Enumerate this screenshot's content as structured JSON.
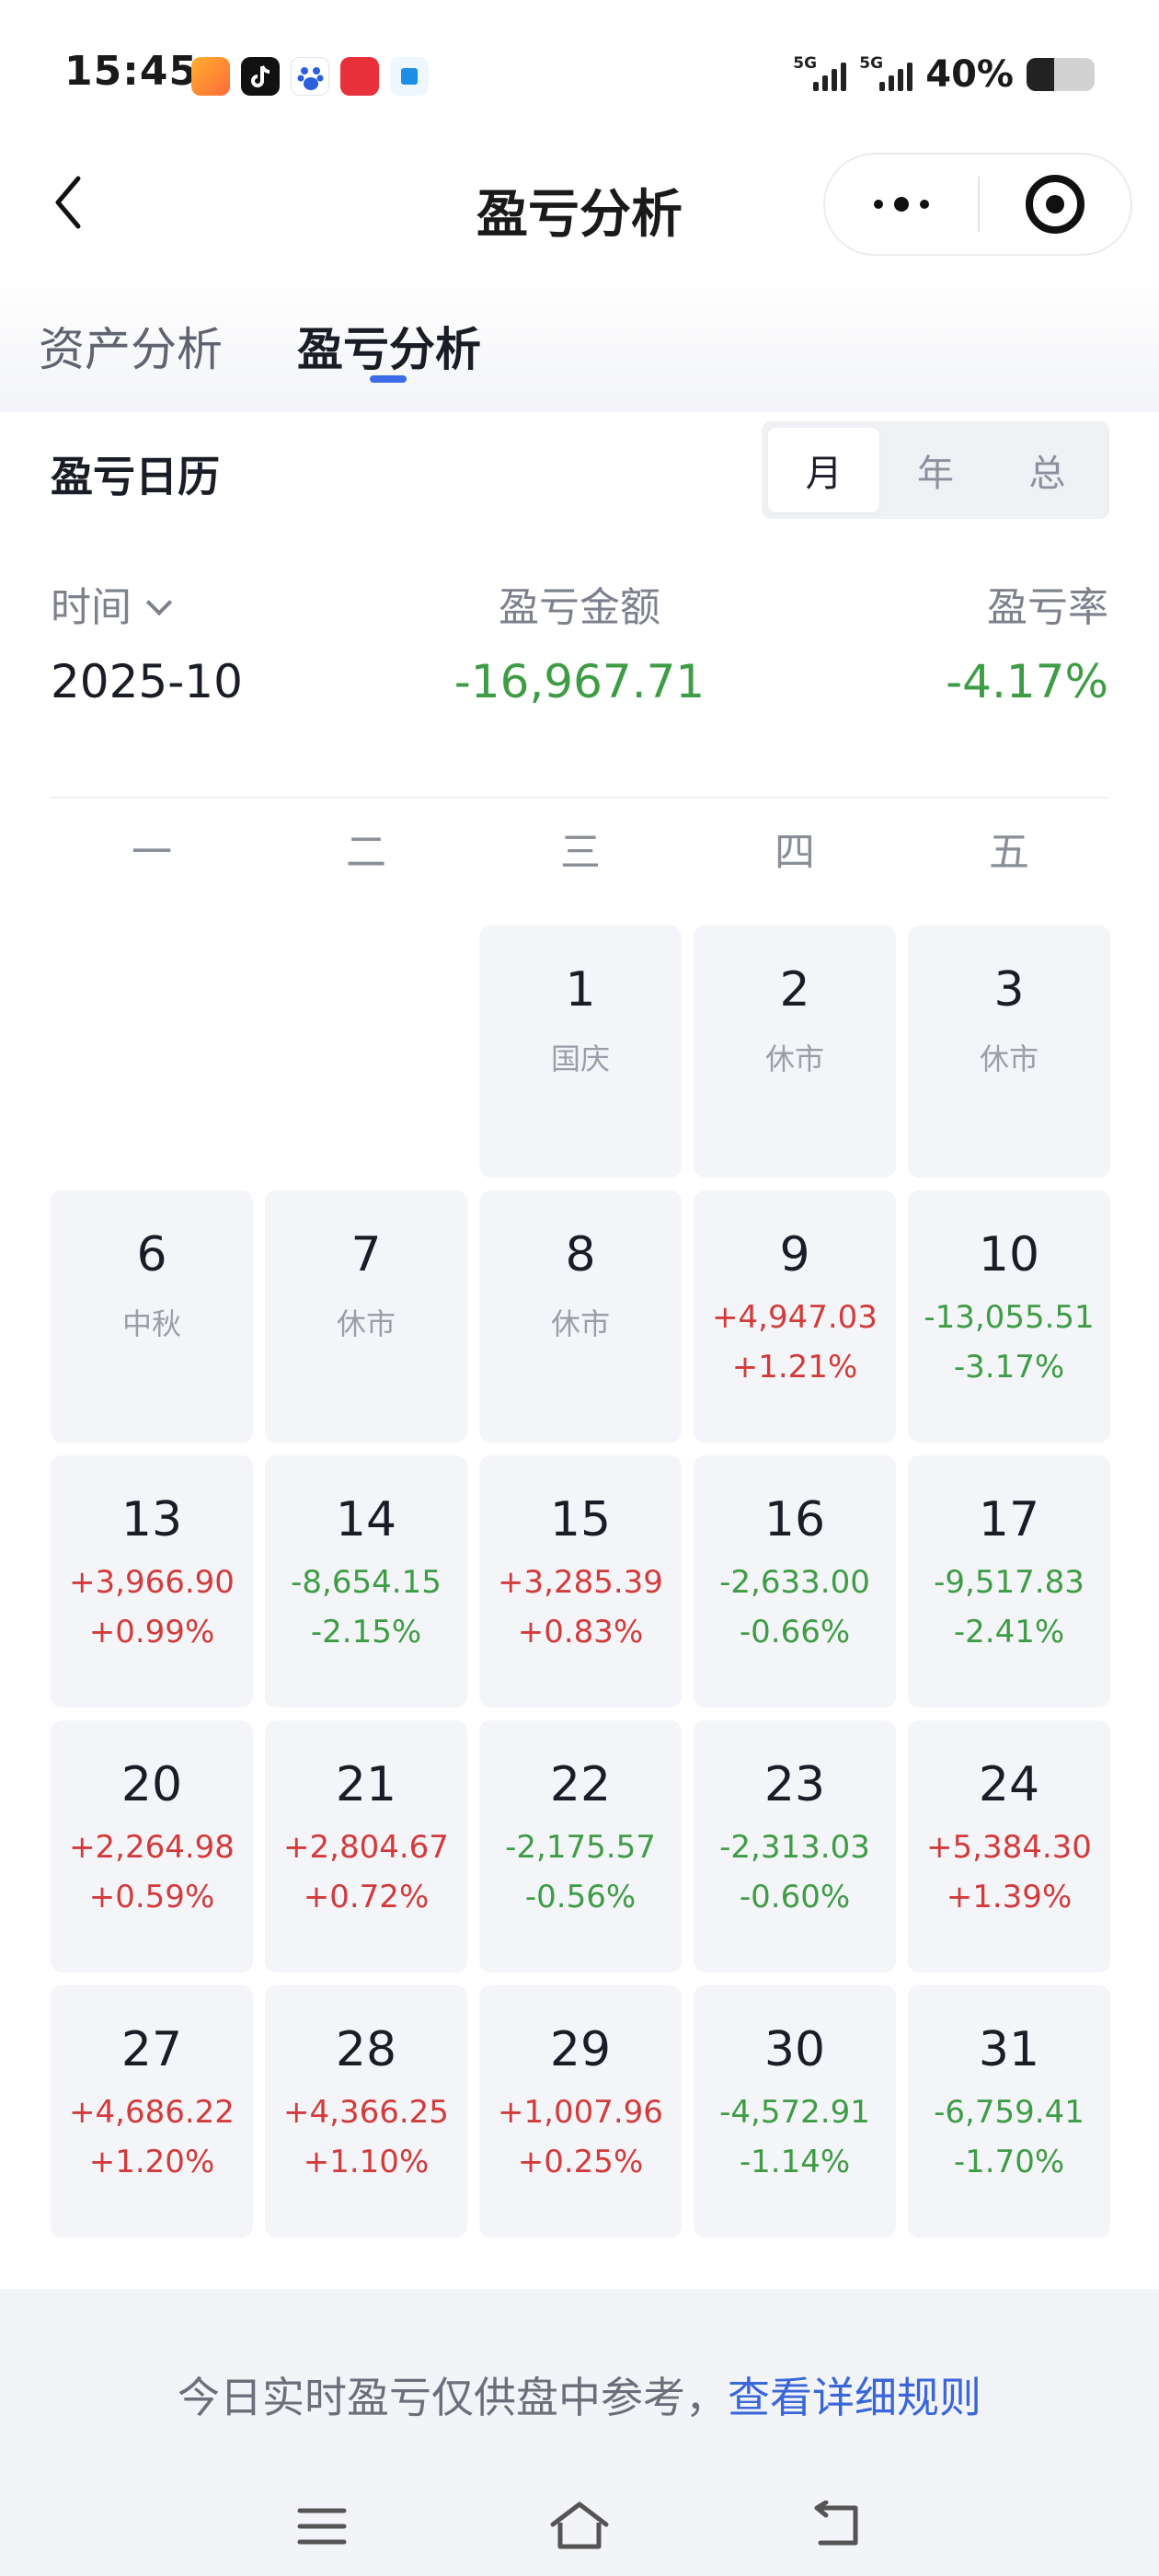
{
  "status_bar": {
    "time": "15:45",
    "network1": "5G",
    "network2": "5G",
    "battery_percent": "40%",
    "battery_level": 0.4,
    "app_icons": [
      "video-app-icon",
      "tiktok-icon",
      "baidu-icon",
      "shopping-app-icon",
      "tool-app-icon"
    ]
  },
  "nav": {
    "title": "盈亏分析"
  },
  "tabs": [
    {
      "label": "资产分析",
      "active": false
    },
    {
      "label": "盈亏分析",
      "active": true
    }
  ],
  "calendar": {
    "title": "盈亏日历",
    "segments": [
      "月",
      "年",
      "总"
    ],
    "active_segment": "月",
    "time_label": "时间",
    "amount_label": "盈亏金额",
    "rate_label": "盈亏率",
    "period": "2025-10",
    "total_amount": "-16,967.71",
    "total_rate": "-4.17%",
    "weekdays": [
      "一",
      "二",
      "三",
      "四",
      "五"
    ],
    "weeks": [
      [
        null,
        null,
        {
          "day": "1",
          "note": "国庆"
        },
        {
          "day": "2",
          "note": "休市"
        },
        {
          "day": "3",
          "note": "休市"
        }
      ],
      [
        {
          "day": "6",
          "note": "中秋"
        },
        {
          "day": "7",
          "note": "休市"
        },
        {
          "day": "8",
          "note": "休市"
        },
        {
          "day": "9",
          "amount": "+4,947.03",
          "rate": "+1.21%",
          "trend": "up"
        },
        {
          "day": "10",
          "amount": "-13,055.51",
          "rate": "-3.17%",
          "trend": "down"
        }
      ],
      [
        {
          "day": "13",
          "amount": "+3,966.90",
          "rate": "+0.99%",
          "trend": "up"
        },
        {
          "day": "14",
          "amount": "-8,654.15",
          "rate": "-2.15%",
          "trend": "down"
        },
        {
          "day": "15",
          "amount": "+3,285.39",
          "rate": "+0.83%",
          "trend": "up"
        },
        {
          "day": "16",
          "amount": "-2,633.00",
          "rate": "-0.66%",
          "trend": "down"
        },
        {
          "day": "17",
          "amount": "-9,517.83",
          "rate": "-2.41%",
          "trend": "down"
        }
      ],
      [
        {
          "day": "20",
          "amount": "+2,264.98",
          "rate": "+0.59%",
          "trend": "up"
        },
        {
          "day": "21",
          "amount": "+2,804.67",
          "rate": "+0.72%",
          "trend": "up"
        },
        {
          "day": "22",
          "amount": "-2,175.57",
          "rate": "-0.56%",
          "trend": "down"
        },
        {
          "day": "23",
          "amount": "-2,313.03",
          "rate": "-0.60%",
          "trend": "down"
        },
        {
          "day": "24",
          "amount": "+5,384.30",
          "rate": "+1.39%",
          "trend": "up"
        }
      ],
      [
        {
          "day": "27",
          "amount": "+4,686.22",
          "rate": "+1.20%",
          "trend": "up"
        },
        {
          "day": "28",
          "amount": "+4,366.25",
          "rate": "+1.10%",
          "trend": "up"
        },
        {
          "day": "29",
          "amount": "+1,007.96",
          "rate": "+0.25%",
          "trend": "up"
        },
        {
          "day": "30",
          "amount": "-4,572.91",
          "rate": "-1.14%",
          "trend": "down"
        },
        {
          "day": "31",
          "amount": "-6,759.41",
          "rate": "-1.70%",
          "trend": "down"
        }
      ]
    ]
  },
  "footer": {
    "note": "今日实时盈亏仅供盘中参考，",
    "link": "查看详细规则"
  },
  "colors": {
    "up": "#d23b3b",
    "down": "#3e9c45",
    "accent": "#3b6be8"
  }
}
